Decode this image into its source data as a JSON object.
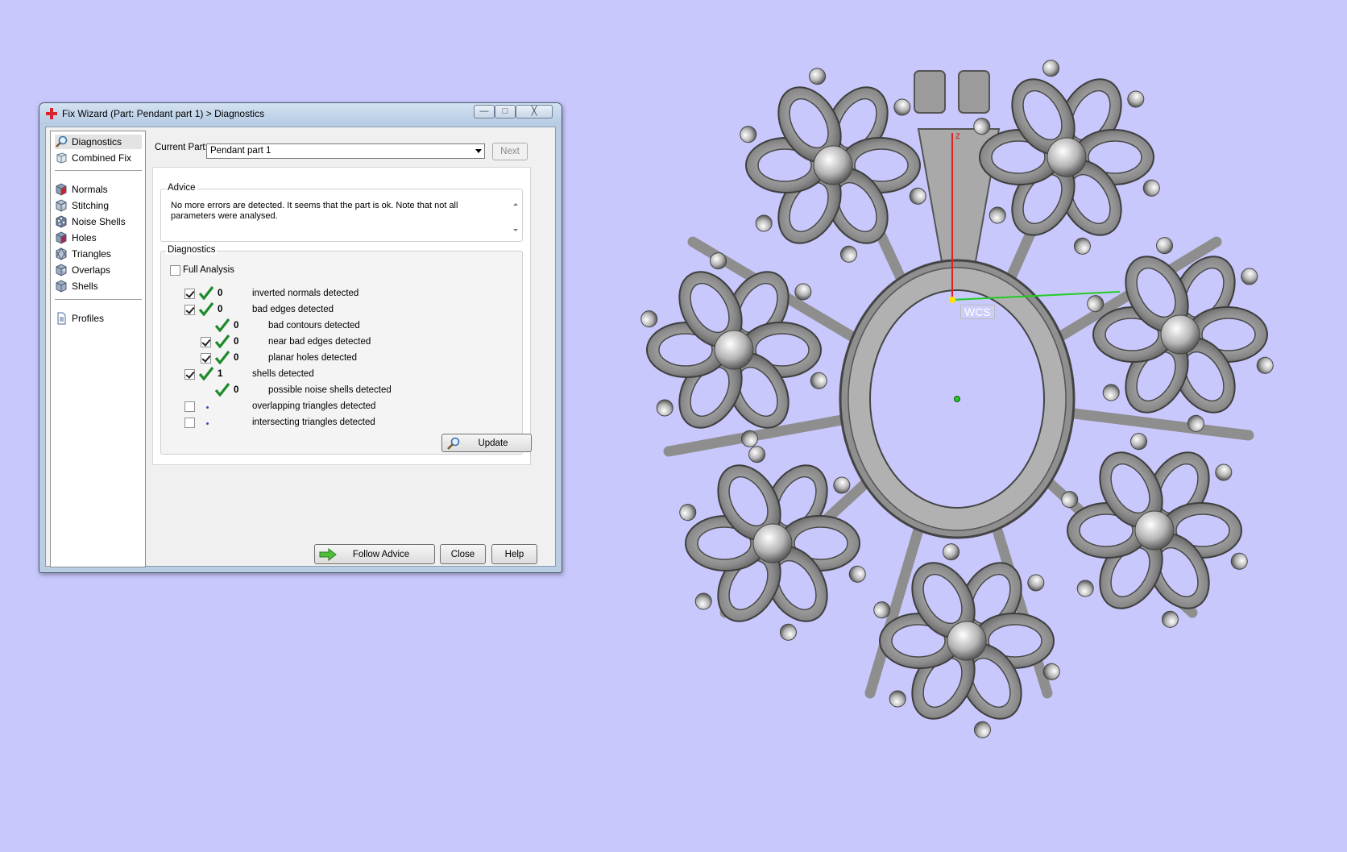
{
  "window": {
    "title": "Fix Wizard (Part: Pendant part 1) > Diagnostics",
    "min_glyph": "—",
    "max_glyph": "□",
    "close_glyph": "╳"
  },
  "nav": {
    "items": [
      {
        "label": "Diagnostics",
        "icon": "magnifier-icon"
      },
      {
        "label": "Combined Fix",
        "icon": "cubes-icon"
      },
      {
        "label": "Normals",
        "icon": "cube-red-icon"
      },
      {
        "label": "Stitching",
        "icon": "cube-stitch-icon"
      },
      {
        "label": "Noise Shells",
        "icon": "cube-noise-icon"
      },
      {
        "label": "Holes",
        "icon": "cube-hole-icon"
      },
      {
        "label": "Triangles",
        "icon": "cube-triangle-icon"
      },
      {
        "label": "Overlaps",
        "icon": "cube-overlap-icon"
      },
      {
        "label": "Shells",
        "icon": "cube-shell-icon"
      },
      {
        "label": "Profiles",
        "icon": "document-icon"
      }
    ]
  },
  "current_part": {
    "label": "Current Part:",
    "value": "Pendant part 1",
    "next_label": "Next"
  },
  "advice": {
    "title": "Advice",
    "text": "No more errors are detected. It seems that the part is ok. Note that not all parameters were analysed."
  },
  "diagnostics": {
    "title": "Diagnostics",
    "full_analysis_label": "Full Analysis",
    "rows": [
      {
        "checked": true,
        "status": "ok",
        "count": "0",
        "text": "inverted normals detected"
      },
      {
        "checked": true,
        "status": "ok",
        "count": "0",
        "text": "bad edges detected"
      },
      {
        "checked": null,
        "status": "ok",
        "count": "0",
        "text": "bad contours detected"
      },
      {
        "checked": true,
        "status": "ok",
        "count": "0",
        "text": "near bad edges detected"
      },
      {
        "checked": true,
        "status": "ok",
        "count": "0",
        "text": "planar holes detected"
      },
      {
        "checked": true,
        "status": "ok",
        "count": "1",
        "text": "shells detected"
      },
      {
        "checked": null,
        "status": "ok",
        "count": "0",
        "text": "possible noise shells detected"
      },
      {
        "checked": false,
        "status": "pending",
        "count": "",
        "text": "overlapping triangles detected"
      },
      {
        "checked": false,
        "status": "pending",
        "count": "",
        "text": "intersecting triangles detected"
      }
    ],
    "update_label": "Update"
  },
  "footer": {
    "follow_advice_label": "Follow Advice",
    "close_label": "Close",
    "help_label": "Help"
  },
  "viewport": {
    "axis_label": "z",
    "wcs_label": "WCS",
    "background": "#c8c8fc"
  }
}
